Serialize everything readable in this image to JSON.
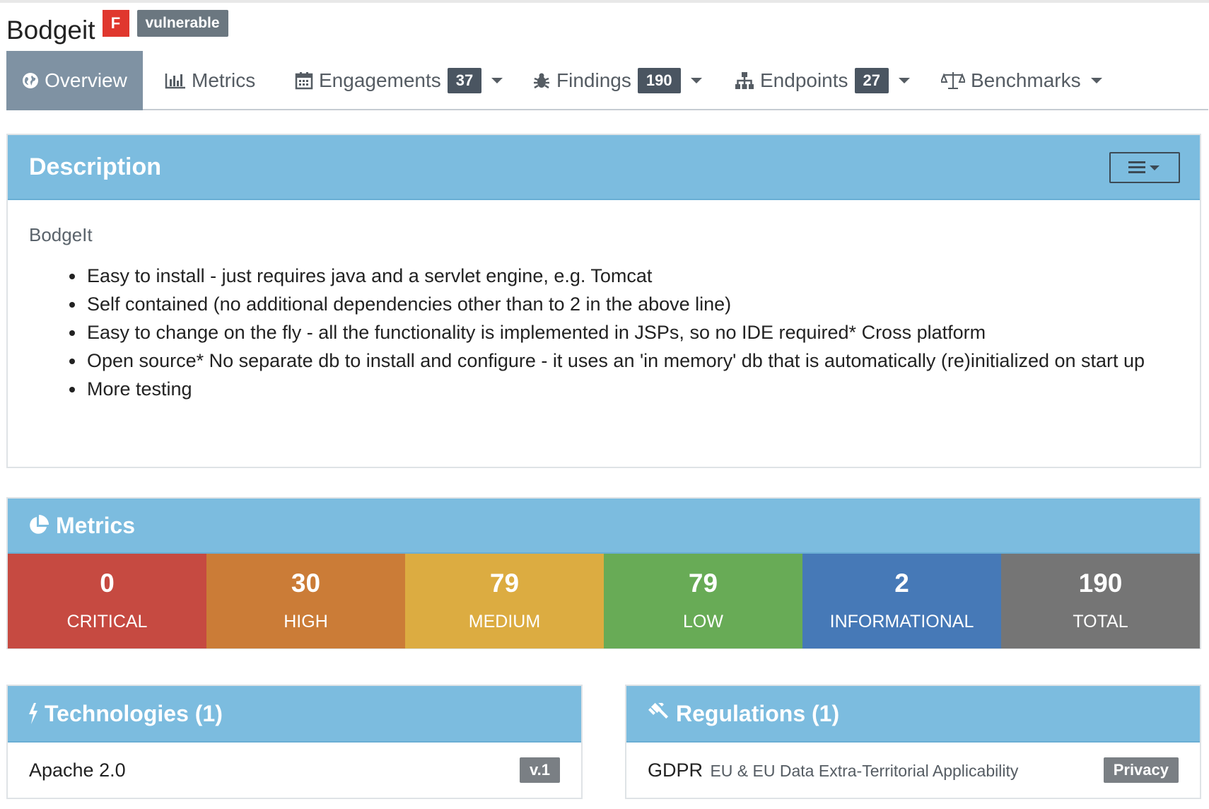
{
  "product": {
    "name": "Bodgeit",
    "grade": "F",
    "tag": "vulnerable"
  },
  "nav": {
    "tabs": [
      {
        "label": "Overview",
        "icon": "globe-icon",
        "active": true
      },
      {
        "label": "Metrics",
        "icon": "bar-chart-icon"
      },
      {
        "label": "Engagements",
        "icon": "calendar-icon",
        "count": "37",
        "dropdown": true
      },
      {
        "label": "Findings",
        "icon": "bug-icon",
        "count": "190",
        "dropdown": true
      },
      {
        "label": "Endpoints",
        "icon": "sitemap-icon",
        "count": "27",
        "dropdown": true
      },
      {
        "label": "Benchmarks",
        "icon": "balance-scale-icon",
        "dropdown": true
      }
    ]
  },
  "description": {
    "header": "Description",
    "title": "BodgeIt",
    "items": [
      "Easy to install - just requires java and a servlet engine, e.g. Tomcat",
      "Self contained (no additional dependencies other than to 2 in the above line)",
      "Easy to change on the fly - all the functionality is implemented in JSPs, so no IDE required* Cross platform",
      "Open source* No separate db to install and configure - it uses an 'in memory' db that is automatically (re)initialized on start up",
      "More testing"
    ]
  },
  "metrics": {
    "header": "Metrics",
    "cells": [
      {
        "value": "0",
        "label": "CRITICAL",
        "color": "#c64a41"
      },
      {
        "value": "30",
        "label": "HIGH",
        "color": "#cb7c37"
      },
      {
        "value": "79",
        "label": "MEDIUM",
        "color": "#dcac41"
      },
      {
        "value": "79",
        "label": "LOW",
        "color": "#68ab56"
      },
      {
        "value": "2",
        "label": "INFORMATIONAL",
        "color": "#4679b7"
      },
      {
        "value": "190",
        "label": "TOTAL",
        "color": "#757575"
      }
    ]
  },
  "technologies": {
    "header": "Technologies (1)",
    "items": [
      {
        "name": "Apache 2.0",
        "version": "v.1"
      }
    ]
  },
  "regulations": {
    "header": "Regulations (1)",
    "items": [
      {
        "name": "GDPR",
        "desc": "EU & EU Data Extra-Territorial Applicability",
        "category": "Privacy"
      }
    ]
  },
  "colors": {
    "panel_header": "#7cbcdf",
    "active_tab": "#7f92a3",
    "grade": "#e0372e",
    "badge": "#4a5561"
  }
}
